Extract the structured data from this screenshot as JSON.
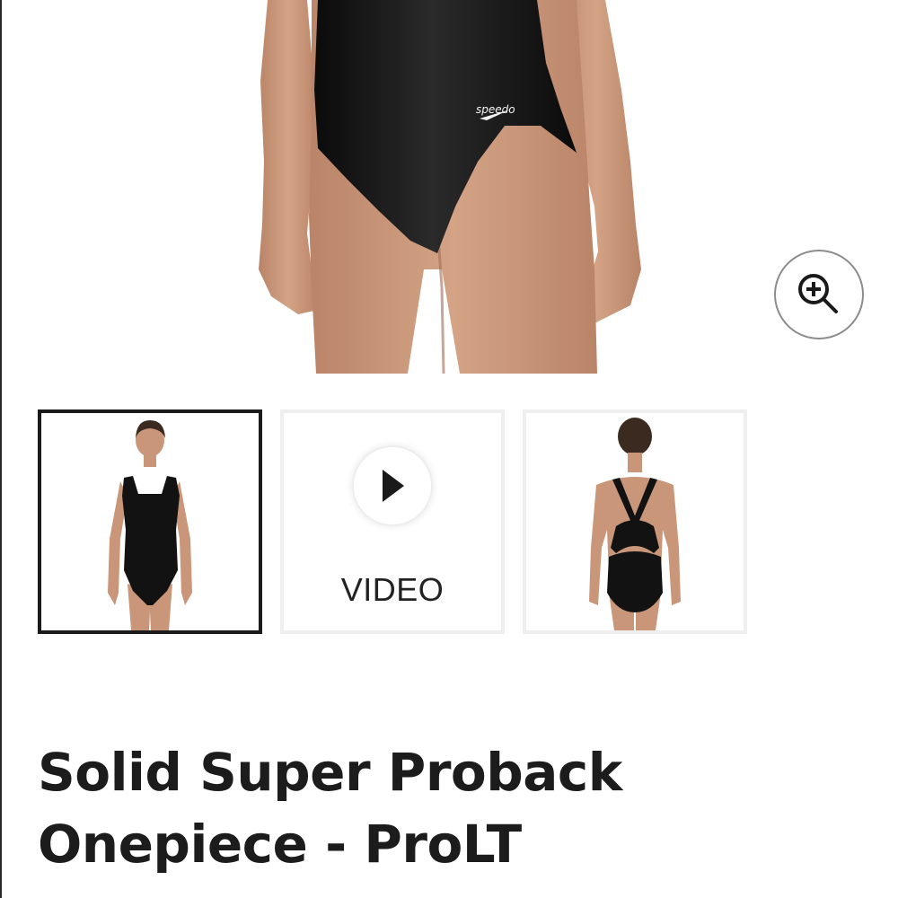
{
  "product": {
    "title_line1": "Solid Super Proback",
    "title_line2": "Onepiece - ProLT",
    "brand_logo_text": "speedo"
  },
  "gallery": {
    "zoom_icon": "zoom-in-icon",
    "thumbnails": [
      {
        "kind": "image",
        "view": "front",
        "selected": true
      },
      {
        "kind": "video",
        "label": "VIDEO",
        "icon": "play-icon",
        "selected": false
      },
      {
        "kind": "image",
        "view": "back",
        "selected": false
      }
    ]
  },
  "colors": {
    "swimsuit": "#121212",
    "skin": "#c9967a",
    "selected_border": "#1a1a1a",
    "thumb_border": "#efefef",
    "title_text": "#1c1c1c"
  }
}
